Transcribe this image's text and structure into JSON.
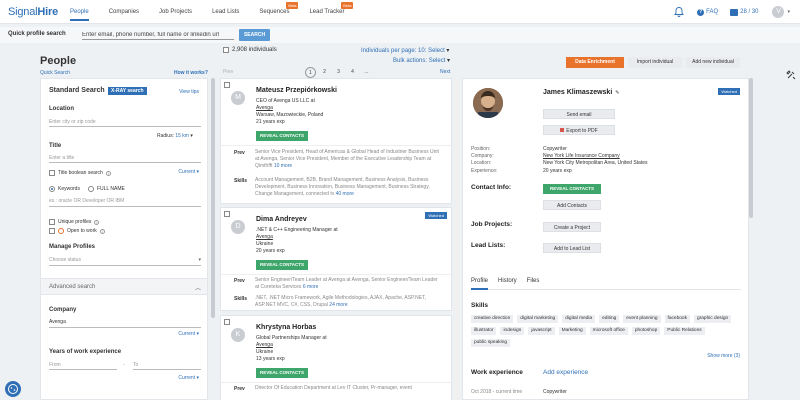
{
  "app": {
    "logo_a": "Signal",
    "logo_b": "Hire"
  },
  "nav": [
    {
      "label": "People",
      "active": true
    },
    {
      "label": "Companies"
    },
    {
      "label": "Job Projects"
    },
    {
      "label": "Lead Lists"
    },
    {
      "label": "Sequences",
      "badge": "Beta"
    },
    {
      "label": "Lead Tracker",
      "badge": "Beta"
    }
  ],
  "top_right": {
    "faq": "FAQ",
    "credits": "28 / 30",
    "avatar": "V"
  },
  "quick_profile": {
    "label": "Quick profile search",
    "placeholder": "Enter email, phone number, full name or linkedin url",
    "button": "SEARCH"
  },
  "page": {
    "title": "People",
    "quick_search": "Quick Search",
    "how_it_works": "How it works?",
    "prev": "Prev",
    "next": "Next"
  },
  "results_toolbar": {
    "count": "2,908 individuals",
    "per_page_label": "Individuals per page: 10:",
    "per_page_select": "Select",
    "bulk_label": "Bulk actions:",
    "bulk_select": "Select"
  },
  "pager": [
    "1",
    "2",
    "3",
    "4",
    "..."
  ],
  "actions": {
    "data_enrichment": "Data Enrichment",
    "import": "Import individual",
    "add_new": "Add new individual"
  },
  "search": {
    "heading": "Standard Search",
    "xray": "X-RAY search",
    "view_tips": "View tips",
    "location_label": "Location",
    "location_placeholder": "Enter city or zip code",
    "radius_label": "Radius:",
    "radius_value": "15 km",
    "title_label": "Title",
    "title_placeholder": "Enter a title",
    "current": "Current",
    "title_boolean": "Title boolean search",
    "keywords": "Keywords",
    "full_name": "FULL NAME",
    "keywords_hint": "ex.: oracle OR Developer OR IBM",
    "unique_profiles": "Unique profiles",
    "open_to_work": "Open to work",
    "manage_profiles": "Manage Profiles",
    "choose_status": "Choose status",
    "advanced": "Advanced search",
    "company_label": "Company",
    "company_value": "Avenga",
    "years_label": "Years of work experience",
    "from": "From",
    "to": "To",
    "dash": "-"
  },
  "cards": [
    {
      "avatar": "M",
      "name": "Mateusz Przepiórkowski",
      "title": "CEO of Avenga US LLC at",
      "company": "Avenga",
      "location": "Warsaw, Mazowieckie, Poland",
      "exp": "21 years exp",
      "reveal": "REVEAL CONTACTS",
      "prev_label": "Prev",
      "prev_text": "Senior Vice President, Head of Americas & Global Head of Industrier Business Unit at Avenga, Senior Vice President, Member of the Executive Leadership Team at Qimthfft",
      "prev_more": "10 more",
      "skills_label": "Skills",
      "skills_text": "Account Management, B2B, Brand Management, Business Analysis, Business Development, Business Innovation, Business Management, Business Strategy, Change Management, connected tv",
      "skills_more": "40 more"
    },
    {
      "avatar": "D",
      "name": "Dima Andreyev",
      "watched": "Watched",
      "title": ".NET & C++ Engineering Manager at",
      "company": "Avenga",
      "location": "Ukraine",
      "exp": "20 years exp",
      "reveal": "REVEAL CONTACTS",
      "prev_label": "Prev",
      "prev_text": "Senior Engineer/Team Leader at Avenga at Avenga, Senior Engineer/Team Leader at Coreteka Services",
      "prev_more": "6 more",
      "skills_label": "Skills",
      "skills_text": ".NET, .NET Micro Framework, Agile Methodologies, AJAX, Apache, ASP.NET, ASP.NET MVC, C#, CSS, Drupal",
      "skills_more": "24 more"
    },
    {
      "avatar": "K",
      "name": "Khrystyna Horbas",
      "title": "Global Partnerships Manager at",
      "company": "Avenga",
      "location": "Ukraine",
      "exp": "13 years exp",
      "reveal": "REVEAL CONTACTS",
      "prev_label": "Prev",
      "prev_text": "Director Of Education Department at Lev IT Cluster, Pr-manager, event"
    }
  ],
  "detail": {
    "name": "James Klimaszewski",
    "watched": "Watched",
    "send_email": "Send email",
    "export_pdf": "Export to PDF",
    "position_label": "Position:",
    "position": "Copywriter",
    "company_label": "Company:",
    "company": "New York Life Insurance Company",
    "location_label": "Location:",
    "location": "New York City Metropolitan Area, United States",
    "experience_label": "Experience:",
    "experience": "20 years exp",
    "contact_info": "Contact Info:",
    "reveal": "REVEAL CONTACTS",
    "add_contacts": "Add Contacts",
    "job_projects": "Job Projects:",
    "create_project": "Create a Project",
    "lead_lists": "Lead Lists:",
    "add_lead": "Add to Lead List",
    "tabs": [
      "Profile",
      "History",
      "Files"
    ],
    "skills_title": "Skills",
    "skills": [
      "creative direction",
      "digital marketing",
      "digital media",
      "editing",
      "event planning",
      "facebook",
      "graphic design",
      "illustrator",
      "indesign",
      "javascript",
      "Marketing",
      "microsoft office",
      "photoshop",
      "Public Relations",
      "public speaking"
    ],
    "show_more": "Show more (3)",
    "work_exp": "Work experience",
    "add_exp": "Add experience",
    "we_date": "Oct 2018 - current time",
    "we_title": "Copywriter"
  },
  "colors": {
    "brand": "#2f6fb5",
    "accent": "#e9732a",
    "success": "#3ea66a"
  }
}
